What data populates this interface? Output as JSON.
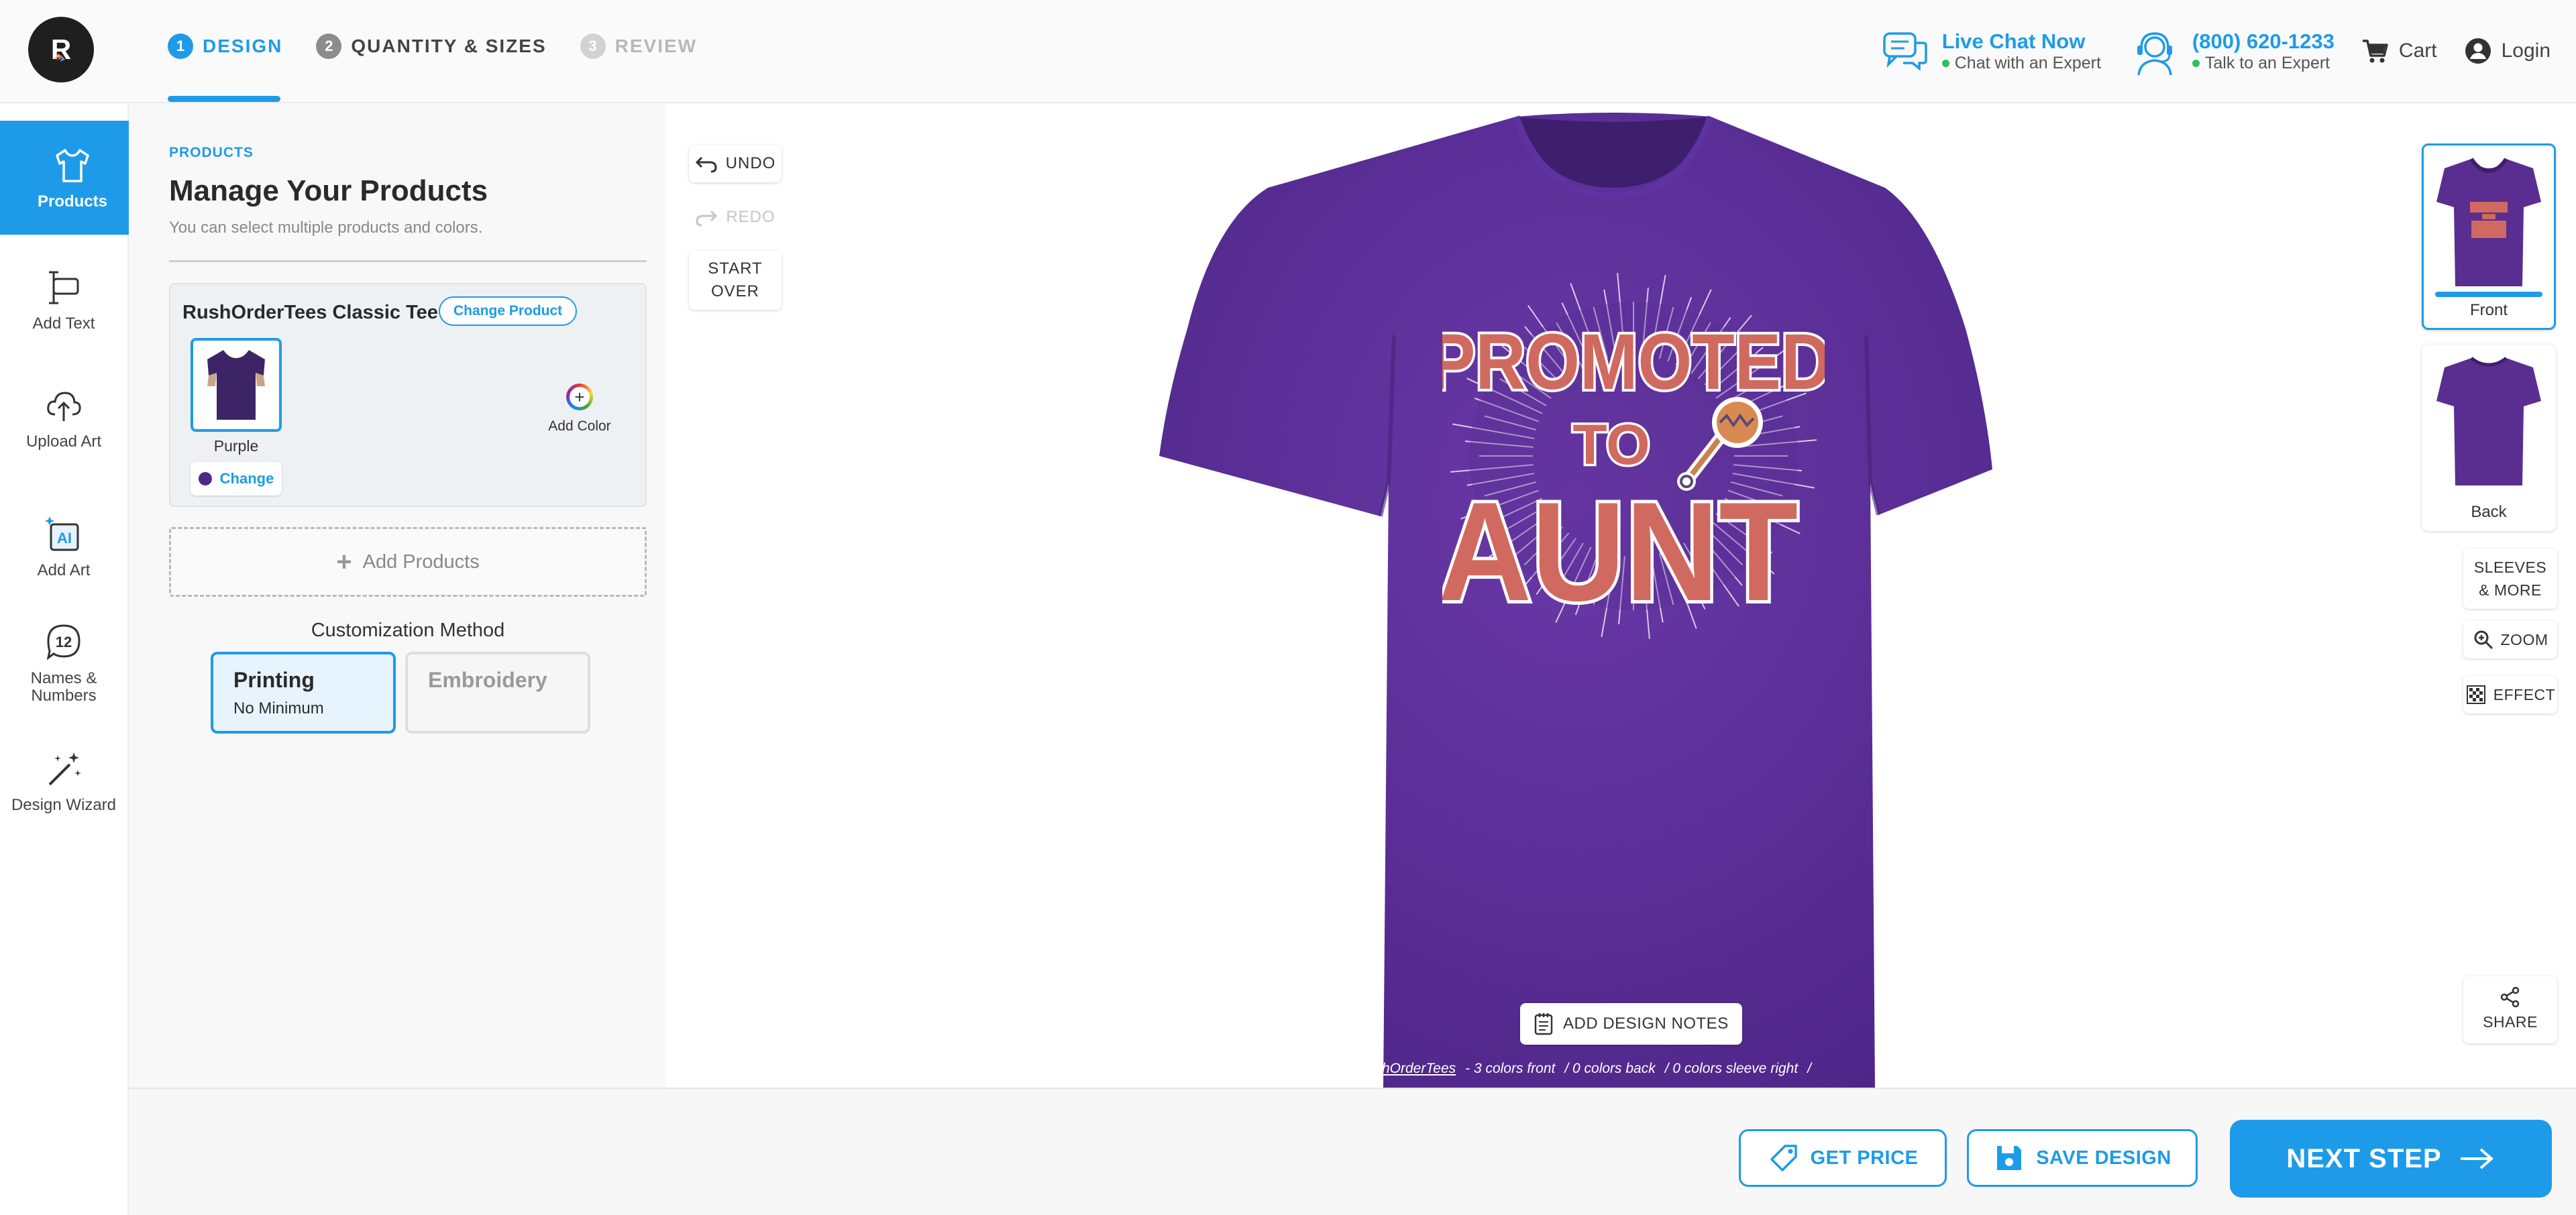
{
  "brand": {
    "logo_letter": "R"
  },
  "steps": [
    {
      "num": "1",
      "label": "DESIGN",
      "state": "active"
    },
    {
      "num": "2",
      "label": "QUANTITY & SIZES",
      "state": "normal"
    },
    {
      "num": "3",
      "label": "REVIEW",
      "state": "disabled"
    }
  ],
  "header": {
    "live_chat_title": "Live Chat Now",
    "live_chat_sub": "Chat with an Expert",
    "phone_title": "(800) 620-1233",
    "phone_sub": "Talk to an Expert",
    "cart": "Cart",
    "login": "Login"
  },
  "rail": {
    "products": "Products",
    "add_text": "Add Text",
    "upload_art": "Upload Art",
    "add_art": "Add Art",
    "names_numbers": "Names & Numbers",
    "design_wizard": "Design Wizard",
    "names_badge": "12",
    "ai_badge": "AI"
  },
  "panel": {
    "eyebrow": "PRODUCTS",
    "title": "Manage Your Products",
    "subtitle": "You can select multiple products and colors.",
    "product_name": "RushOrderTees Classic Tee",
    "change_product": "Change Product",
    "color_name": "Purple",
    "color_change": "Change",
    "add_color": "Add Color",
    "add_products": "Add Products",
    "customization_title": "Customization Method",
    "printing_title": "Printing",
    "printing_sub": "No Minimum",
    "embroidery_title": "Embroidery"
  },
  "canvas": {
    "undo": "UNDO",
    "redo": "REDO",
    "start_over_1": "START",
    "start_over_2": "OVER",
    "design_line1": "PROMOTED",
    "design_line2": "TO",
    "design_line3": "AUNT",
    "design_notes": "ADD DESIGN NOTES",
    "color_info_brand": "hOrderTees",
    "color_info_front": "- 3 colors front",
    "color_info_back": "/  0 colors back",
    "color_info_sleeve": "/  0 colors sleeve right",
    "color_info_sep": "/",
    "view_front": "Front",
    "view_back": "Back",
    "sleeves_1": "SLEEVES",
    "sleeves_2": "& MORE",
    "zoom": "ZOOM",
    "effect": "EFFECT",
    "share": "SHARE"
  },
  "footer": {
    "get_price": "GET PRICE",
    "save_design": "SAVE DESIGN",
    "next_step": "NEXT STEP"
  },
  "colors": {
    "accent": "#1e9be8",
    "shirt": "#5a2d91",
    "design_text": "#d0695f",
    "logo_bg": "#1f1f1f"
  }
}
